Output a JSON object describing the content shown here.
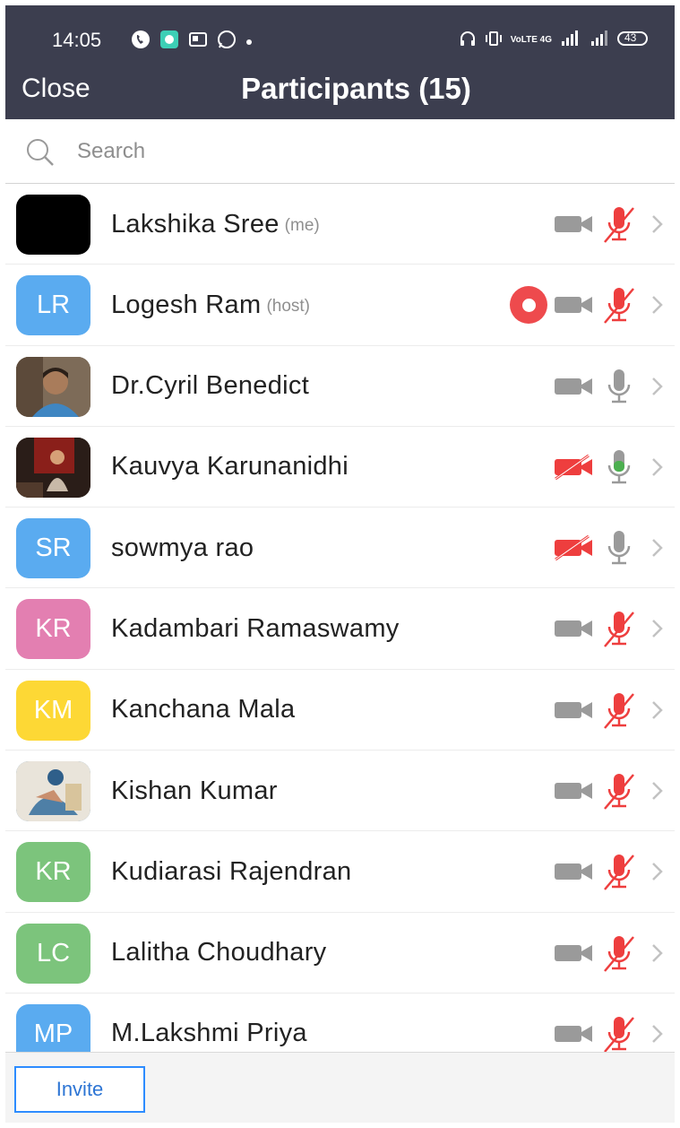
{
  "status_bar": {
    "time": "14:05",
    "right_text": "VoLTE 4G",
    "battery": "43"
  },
  "header": {
    "close_label": "Close",
    "title": "Participants (15)"
  },
  "search": {
    "placeholder": "Search"
  },
  "participants": [
    {
      "name": "Lakshika Sree",
      "tag": "(me)",
      "avatar_type": "black",
      "initials": "",
      "avatar_color": "#000000",
      "video": "off",
      "mic": "muted",
      "recording": false
    },
    {
      "name": "Logesh Ram",
      "tag": "(host)",
      "avatar_type": "initials",
      "initials": "LR",
      "avatar_color": "#5aabf0",
      "video": "off",
      "mic": "muted",
      "recording": true
    },
    {
      "name": "Dr.Cyril Benedict",
      "tag": "",
      "avatar_type": "photo-person",
      "initials": "",
      "avatar_color": "#6b5a4a",
      "video": "off",
      "mic": "on",
      "recording": false
    },
    {
      "name": "Kauvya Karunanidhi",
      "tag": "",
      "avatar_type": "photo-dark",
      "initials": "",
      "avatar_color": "#3a2a22",
      "video": "blocked",
      "mic": "talking",
      "recording": false
    },
    {
      "name": "sowmya rao",
      "tag": "",
      "avatar_type": "initials",
      "initials": "SR",
      "avatar_color": "#5aabf0",
      "video": "blocked",
      "mic": "on",
      "recording": false
    },
    {
      "name": "Kadambari Ramaswamy",
      "tag": "",
      "avatar_type": "initials",
      "initials": "KR",
      "avatar_color": "#e37fb1",
      "video": "off",
      "mic": "muted",
      "recording": false
    },
    {
      "name": "Kanchana Mala",
      "tag": "",
      "avatar_type": "initials",
      "initials": "KM",
      "avatar_color": "#fdd835",
      "video": "off",
      "mic": "muted",
      "recording": false
    },
    {
      "name": "Kishan Kumar",
      "tag": "",
      "avatar_type": "photo-art",
      "initials": "",
      "avatar_color": "#4e7fa6",
      "video": "off",
      "mic": "muted",
      "recording": false
    },
    {
      "name": "Kudiarasi Rajendran",
      "tag": "",
      "avatar_type": "initials",
      "initials": "KR",
      "avatar_color": "#7cc47c",
      "video": "off",
      "mic": "muted",
      "recording": false
    },
    {
      "name": "Lalitha Choudhary",
      "tag": "",
      "avatar_type": "initials",
      "initials": "LC",
      "avatar_color": "#7cc47c",
      "video": "off",
      "mic": "muted",
      "recording": false
    },
    {
      "name": "M.Lakshmi Priya",
      "tag": "",
      "avatar_type": "initials",
      "initials": "MP",
      "avatar_color": "#5aabf0",
      "video": "off",
      "mic": "muted",
      "recording": false
    }
  ],
  "footer": {
    "invite_label": "Invite"
  },
  "colors": {
    "header_bg": "#3c3e4f",
    "muted_red": "#ee3e3e",
    "icon_gray": "#9a9a9a",
    "talking_green": "#4caf50",
    "invite_blue": "#2d8cff"
  }
}
